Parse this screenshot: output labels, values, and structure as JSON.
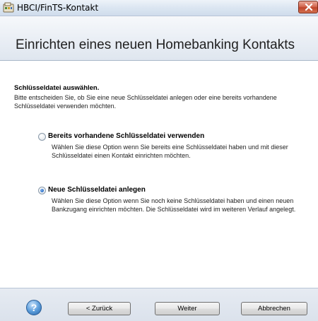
{
  "window": {
    "title": "HBCI/FinTS-Kontakt"
  },
  "header": {
    "title": "Einrichten eines neuen Homebanking Kontakts"
  },
  "section": {
    "title": "Schlüsseldatei auswählen.",
    "description": "Bitte entscheiden Sie, ob Sie eine neue Schlüsseldatei anlegen oder eine bereits vorhandene Schlüsseldatei verwenden möchten."
  },
  "options": [
    {
      "label": "Bereits vorhandene Schlüsseldatei verwenden",
      "description": "Wählen Sie diese Option wenn Sie bereits eine Schlüsseldatei haben und mit dieser Schlüsseldatei einen Kontakt einrichten möchten.",
      "selected": false
    },
    {
      "label": "Neue Schlüsseldatei anlegen",
      "description": "Wählen Sie diese Option wenn Sie noch keine Schlüsseldatei haben und einen neuen Bankzugang einrichten möchten. Die Schlüsseldatei wird im weiteren Verlauf angelegt.",
      "selected": true
    }
  ],
  "footer": {
    "help_icon": "help-icon",
    "back_label": "< Zurück",
    "next_label": "Weiter",
    "cancel_label": "Abbrechen"
  },
  "colors": {
    "close_button": "#c0452b",
    "radio_selected": "#2a6fc9"
  }
}
